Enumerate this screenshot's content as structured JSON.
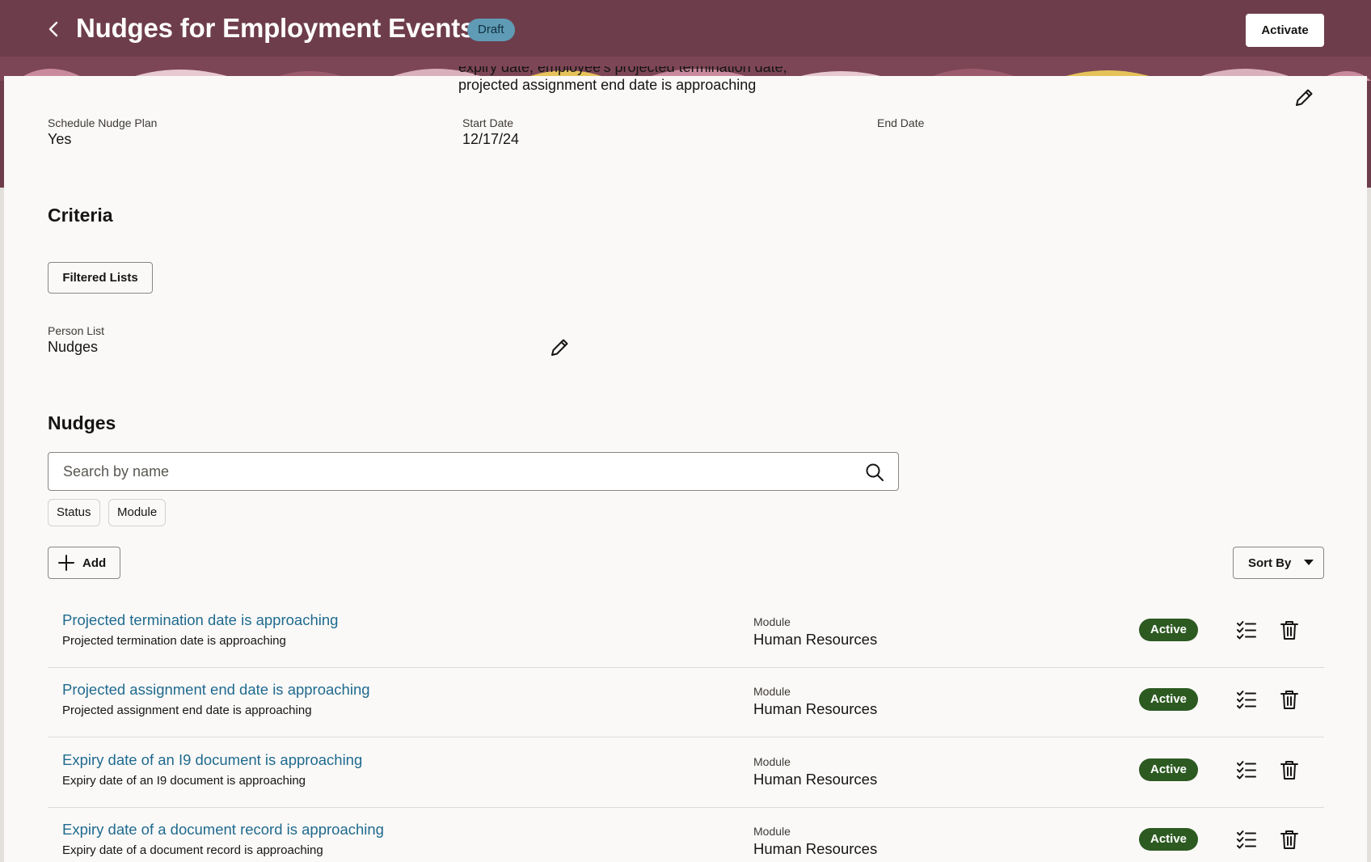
{
  "header": {
    "title": "Nudges for Employment Events",
    "status_badge": "Draft",
    "activate_label": "Activate",
    "background_color": "#6e3d4b"
  },
  "overview": {
    "description_line_clipped": "expiry date, employee's projected termination date,",
    "description_line_visible": "projected assignment end date is approaching",
    "fields": [
      {
        "label": "Schedule Nudge Plan",
        "value": "Yes"
      },
      {
        "label": "Start Date",
        "value": "12/17/24"
      },
      {
        "label": "End Date",
        "value": ""
      }
    ]
  },
  "criteria": {
    "heading": "Criteria",
    "filtered_lists_label": "Filtered Lists",
    "person_list_label": "Person List",
    "person_list_value": "Nudges"
  },
  "nudges": {
    "heading": "Nudges",
    "search_placeholder": "Search by name",
    "filter_chips": [
      "Status",
      "Module"
    ],
    "add_label": "Add",
    "sort_label": "Sort By",
    "items": [
      {
        "title": "Projected termination date is approaching",
        "description": "Projected termination date is approaching",
        "module_label": "Module",
        "module": "Human Resources",
        "status": "Active"
      },
      {
        "title": "Projected assignment end date is approaching",
        "description": "Projected assignment end date is approaching",
        "module_label": "Module",
        "module": "Human Resources",
        "status": "Active"
      },
      {
        "title": "Expiry date of an I9 document is approaching",
        "description": "Expiry date of an I9 document is approaching",
        "module_label": "Module",
        "module": "Human Resources",
        "status": "Active"
      },
      {
        "title": "Expiry date of a document record is approaching",
        "description": "Expiry date of a document record is approaching",
        "module_label": "Module",
        "module": "Human Resources",
        "status": "Active"
      }
    ]
  },
  "colors": {
    "link": "#1f6a8e",
    "active_badge": "#2c5a21",
    "draft_badge": "#5f9bb5"
  },
  "icons": [
    "chevron-left-icon",
    "pencil-icon",
    "search-icon",
    "plus-icon",
    "caret-down-icon",
    "checklist-icon",
    "trash-icon"
  ]
}
